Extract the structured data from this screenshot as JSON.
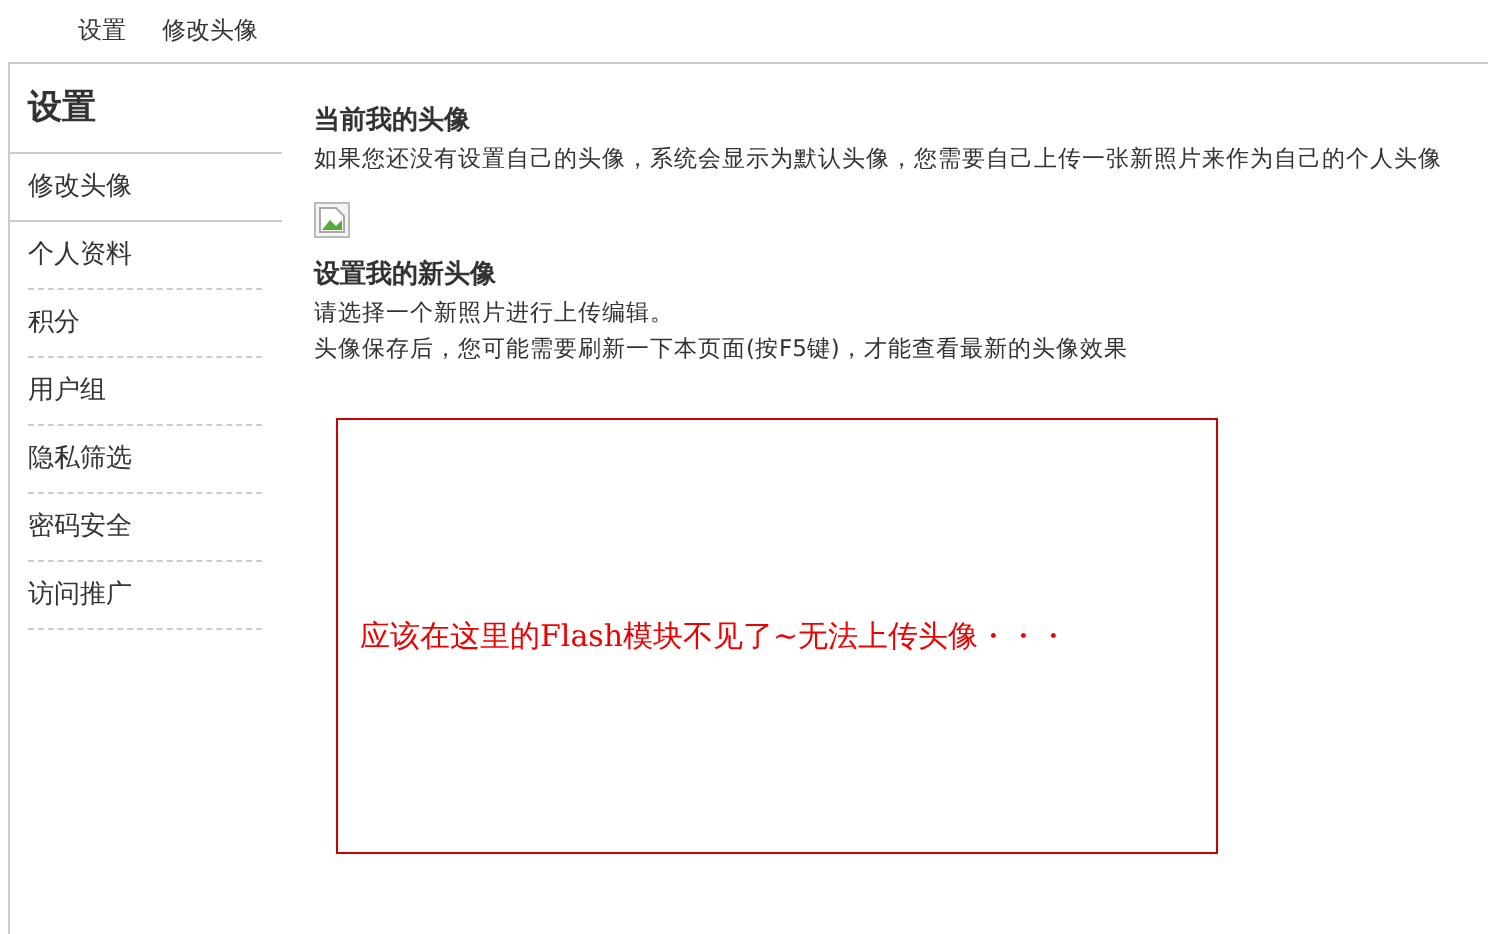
{
  "breadcrumb": [
    "设置",
    "修改头像"
  ],
  "sidebar": {
    "title": "设置",
    "items": [
      {
        "label": "修改头像",
        "selected": true
      },
      {
        "label": "个人资料",
        "selected": false
      },
      {
        "label": "积分",
        "selected": false
      },
      {
        "label": "用户组",
        "selected": false
      },
      {
        "label": "隐私筛选",
        "selected": false
      },
      {
        "label": "密码安全",
        "selected": false
      },
      {
        "label": "访问推广",
        "selected": false
      }
    ]
  },
  "current_avatar": {
    "heading": "当前我的头像",
    "description": "如果您还没有设置自己的头像，系统会显示为默认头像，您需要自己上传一张新照片来作为自己的个人头像"
  },
  "new_avatar": {
    "heading": "设置我的新头像",
    "lines": [
      "请选择一个新照片进行上传编辑。",
      "头像保存后，您可能需要刷新一下本页面(按F5键)，才能查看最新的头像效果"
    ]
  },
  "annotation": "应该在这里的Flash模块不见了~无法上传头像・・・"
}
